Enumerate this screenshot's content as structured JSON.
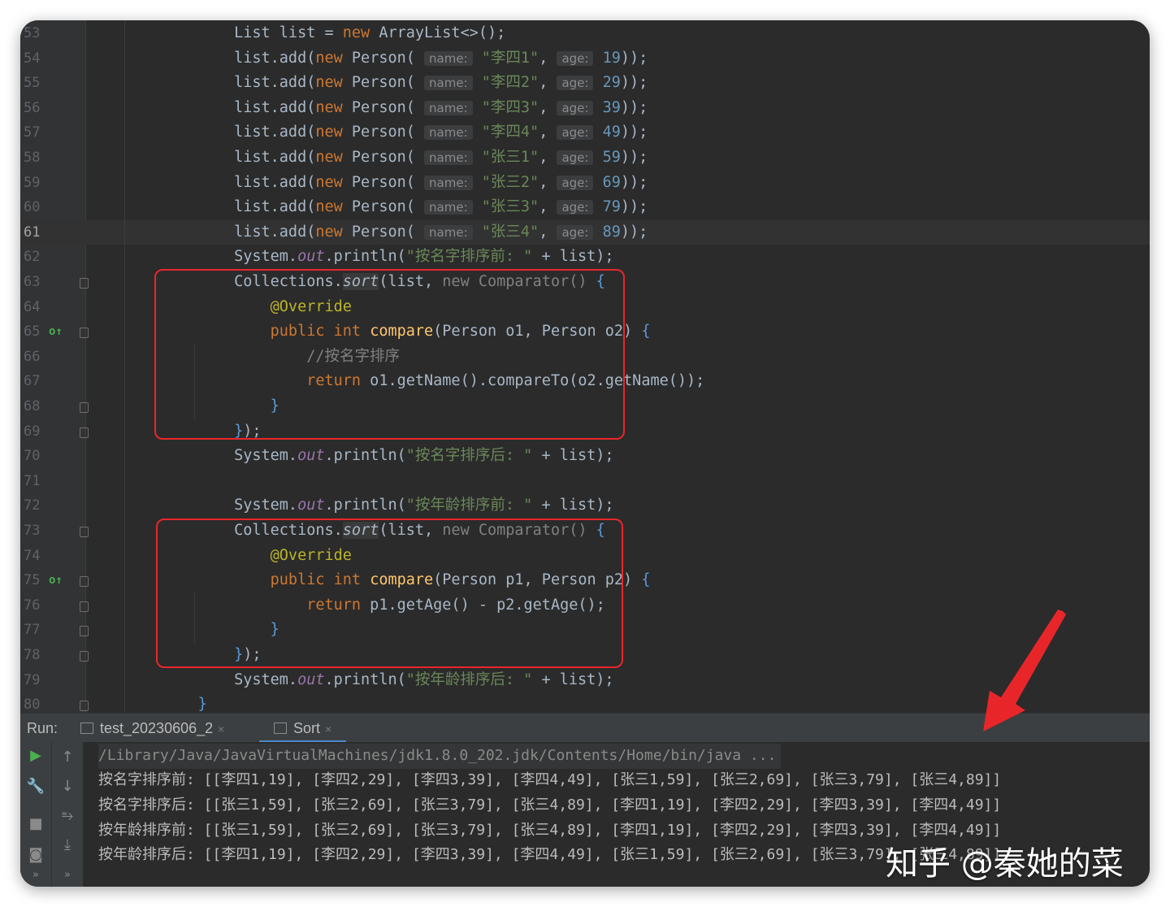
{
  "editor": {
    "current_line": "61",
    "lines": [
      {
        "n": "53",
        "html": "        List<Person> list = <span class=\"kw\">new</span> ArrayList<>();"
      },
      {
        "n": "54",
        "html": "        list.add(<span class=\"kw\">new</span> Person( <span class=\"hint\">name:</span> <span class=\"str\">\"李四1\"</span>, <span class=\"hint\">age:</span> <span class=\"num\">19</span>));"
      },
      {
        "n": "55",
        "html": "        list.add(<span class=\"kw\">new</span> Person( <span class=\"hint\">name:</span> <span class=\"str\">\"李四2\"</span>, <span class=\"hint\">age:</span> <span class=\"num\">29</span>));"
      },
      {
        "n": "56",
        "html": "        list.add(<span class=\"kw\">new</span> Person( <span class=\"hint\">name:</span> <span class=\"str\">\"李四3\"</span>, <span class=\"hint\">age:</span> <span class=\"num\">39</span>));"
      },
      {
        "n": "57",
        "html": "        list.add(<span class=\"kw\">new</span> Person( <span class=\"hint\">name:</span> <span class=\"str\">\"李四4\"</span>, <span class=\"hint\">age:</span> <span class=\"num\">49</span>));"
      },
      {
        "n": "58",
        "html": "        list.add(<span class=\"kw\">new</span> Person( <span class=\"hint\">name:</span> <span class=\"str\">\"张三1\"</span>, <span class=\"hint\">age:</span> <span class=\"num\">59</span>));"
      },
      {
        "n": "59",
        "html": "        list.add(<span class=\"kw\">new</span> Person( <span class=\"hint\">name:</span> <span class=\"str\">\"张三2\"</span>, <span class=\"hint\">age:</span> <span class=\"num\">69</span>));"
      },
      {
        "n": "60",
        "html": "        list.add(<span class=\"kw\">new</span> Person( <span class=\"hint\">name:</span> <span class=\"str\">\"张三3\"</span>, <span class=\"hint\">age:</span> <span class=\"num\">79</span>));"
      },
      {
        "n": "61",
        "html": "        list.add(<span class=\"kw\">new</span> Person( <span class=\"hint\">name:</span> <span class=\"str\">\"张三4\"</span>, <span class=\"hint\">age:</span> <span class=\"num\">89</span>));"
      },
      {
        "n": "62",
        "html": "        System.<span class=\"st\">out</span>.println(<span class=\"str\">\"按名字排序前: \"</span> + list);"
      },
      {
        "n": "63",
        "html": "        Collections.<span class=\"sortm\">sort</span>(list, <span class=\"dim\">new Comparator<Person>()</span> <span class=\"brk\">{</span>"
      },
      {
        "n": "64",
        "html": "            <span class=\"ann\">@Override</span>"
      },
      {
        "n": "65",
        "html": "            <span class=\"kw\">public int</span> <span class=\"fn\">compare</span>(Person o1, Person o2) <span class=\"brk\">{</span>"
      },
      {
        "n": "66",
        "html": "                <span class=\"cmt\">//按名字排序</span>"
      },
      {
        "n": "67",
        "html": "                <span class=\"kw\">return</span> o1.getName().compareTo(o2.getName());"
      },
      {
        "n": "68",
        "html": "            <span class=\"brk\">}</span>"
      },
      {
        "n": "69",
        "html": "        <span class=\"brk\">}</span>);"
      },
      {
        "n": "70",
        "html": "        System.<span class=\"st\">out</span>.println(<span class=\"str\">\"按名字排序后: \"</span> + list);"
      },
      {
        "n": "71",
        "html": ""
      },
      {
        "n": "72",
        "html": "        System.<span class=\"st\">out</span>.println(<span class=\"str\">\"按年龄排序前: \"</span> + list);"
      },
      {
        "n": "73",
        "html": "        Collections.<span class=\"sortm\">sort</span>(list, <span class=\"dim\">new Comparator<Person>()</span> <span class=\"brk\">{</span>"
      },
      {
        "n": "74",
        "html": "            <span class=\"ann\">@Override</span>"
      },
      {
        "n": "75",
        "html": "            <span class=\"kw\">public int</span> <span class=\"fn\">compare</span>(Person p1, Person p2) <span class=\"brk\">{</span>"
      },
      {
        "n": "76",
        "html": "                <span class=\"kw\">return</span> p1.getAge() - p2.getAge();"
      },
      {
        "n": "77",
        "html": "            <span class=\"brk\">}</span>"
      },
      {
        "n": "78",
        "html": "        <span class=\"brk\">}</span>);"
      },
      {
        "n": "79",
        "html": "        System.<span class=\"st\">out</span>.println(<span class=\"str\">\"按年龄排序后: \"</span> + list);"
      },
      {
        "n": "80",
        "html": "    <span class=\"brk\">}</span>"
      }
    ]
  },
  "run_panel": {
    "label": "Run:",
    "tabs": [
      {
        "label": "test_20230606_2",
        "close": "×"
      },
      {
        "label": "Sort",
        "close": "×"
      }
    ],
    "console_lines": [
      "/Library/Java/JavaVirtualMachines/jdk1.8.0_202.jdk/Contents/Home/bin/java ...",
      "按名字排序前: [[李四1,19], [李四2,29], [李四3,39], [李四4,49], [张三1,59], [张三2,69], [张三3,79], [张三4,89]]",
      "按名字排序后: [[张三1,59], [张三2,69], [张三3,79], [张三4,89], [李四1,19], [李四2,29], [李四3,39], [李四4,49]]",
      "按年龄排序前: [[张三1,59], [张三2,69], [张三3,79], [张三4,89], [李四1,19], [李四2,29], [李四3,39], [李四4,49]]",
      "按年龄排序后: [[李四1,19], [李四2,29], [李四3,39], [李四4,49], [张三1,59], [张三2,69], [张三3,79], [张三4,89]]"
    ]
  },
  "watermark": "知乎 @秦她的菜",
  "colors": {
    "highlight_box": "#e8262a",
    "arrow": "#e8262a"
  }
}
